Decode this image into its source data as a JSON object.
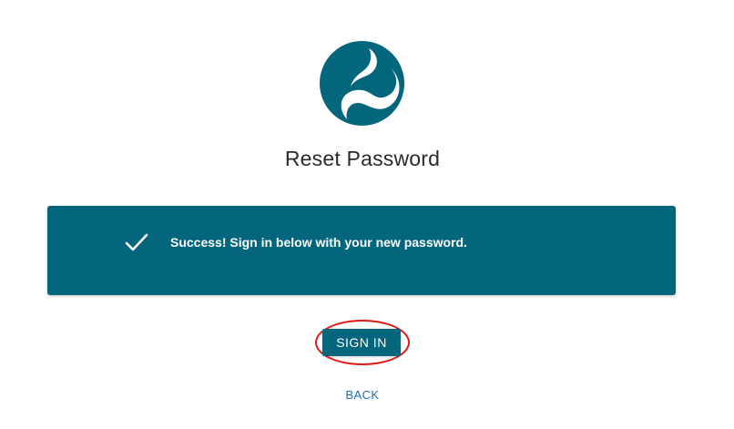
{
  "logo": {
    "icon": "brand-swirl-logo",
    "color": "#04667d"
  },
  "header": {
    "title": "Reset Password"
  },
  "alert": {
    "icon": "checkmark-icon",
    "message": "Success! Sign in below with your new password.",
    "background": "#04667d"
  },
  "actions": {
    "signin_label": "SIGN IN",
    "back_label": "BACK",
    "highlight_color": "#e01818",
    "link_color": "#1f6fb2"
  }
}
